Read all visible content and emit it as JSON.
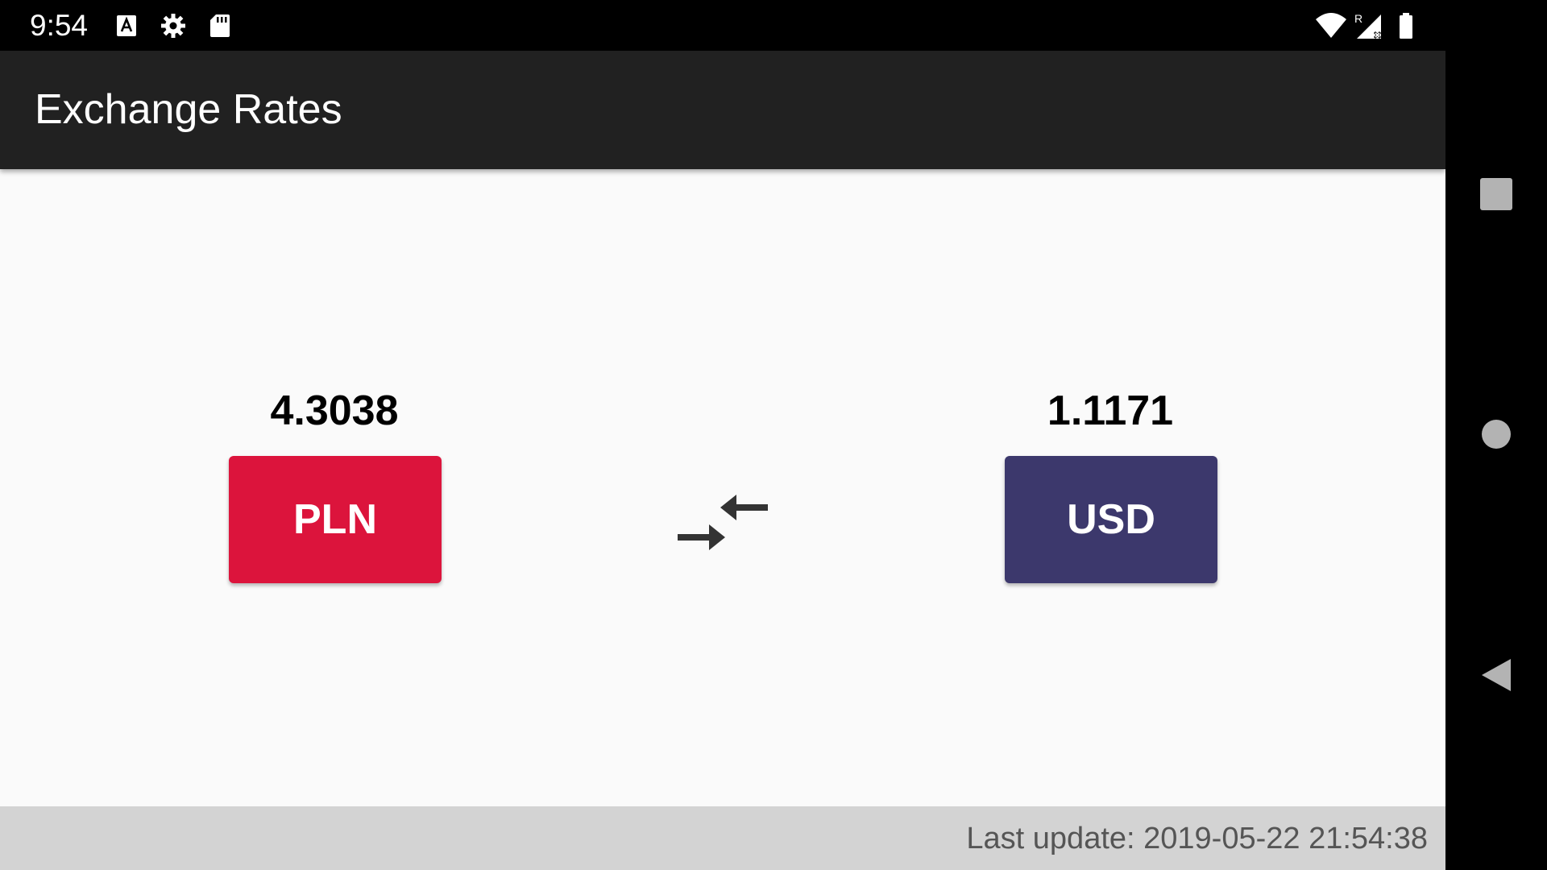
{
  "status_bar": {
    "time": "9:54",
    "left_icons": [
      "a-keyboard-icon",
      "gear-icon",
      "sd-card-icon"
    ],
    "right_icons": [
      "wifi-icon",
      "signal-roaming-icon",
      "battery-icon"
    ],
    "roaming_letter": "R"
  },
  "app_bar": {
    "title": "Exchange Rates"
  },
  "rates": {
    "left": {
      "value": "4.3038",
      "currency": "PLN",
      "color": "#dc143c"
    },
    "right": {
      "value": "1.1171",
      "currency": "USD",
      "color": "#3c386c"
    },
    "swap_icon": "swap-arrows-icon"
  },
  "footer": {
    "last_update_label": "Last update:",
    "last_update_value": "2019-05-22 21:54:38"
  },
  "nav_bar": {
    "icons": [
      "recents-square-icon",
      "home-circle-icon",
      "back-triangle-icon"
    ]
  },
  "colors": {
    "app_bar": "#212121",
    "background": "#fafafa",
    "footer": "#d3d3d3"
  }
}
